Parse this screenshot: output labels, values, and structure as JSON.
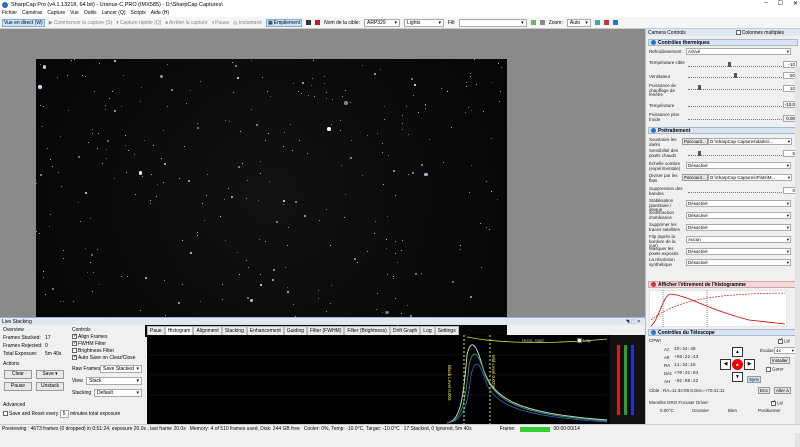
{
  "window": {
    "title": "SharpCap Pro (v4.1.13218, 64 bit) - Uranus-C PRO (IMX585) - D:\\SharpCap Captures\\"
  },
  "menu": [
    "Fichier",
    "Caméras",
    "Capture",
    "Vue",
    "Outils",
    "Lancer (Q)",
    "Scripts",
    "Aide (H)"
  ],
  "toolbar": {
    "live_view": "Vue en direct (W)",
    "start_capture": "Commencer la capture (S)",
    "quick_capture": "Capture rapide (Q)",
    "stop_capture": "Arrêter la capture",
    "pause": "Pause",
    "snapshot": "Instantané",
    "stacking": "Empilement",
    "target_label": "Nom de la cible:",
    "target_value": "ARP329",
    "frame_type": "Lights",
    "filter_label": "Filt",
    "zoom_label": "Zoom:",
    "zoom_value": "Auto"
  },
  "live_stacking": {
    "title": "Live Stacking",
    "overview_label": "Overview",
    "frames_stacked_label": "Frames Stacked:",
    "frames_stacked": "17",
    "frames_rejected_label": "Frames Rejected:",
    "frames_rejected": "0",
    "total_exposure_label": "Total Exposure:",
    "total_exposure": "5m 40s",
    "actions_label": "Actions",
    "clear": "Clear",
    "save": "Save",
    "pause": "Pause",
    "unstack": "Unstack",
    "advanced_label": "Advanced",
    "save_reset_label": "Save and Reset every",
    "save_reset_value": "5",
    "save_reset_suffix": "minutes total exposure",
    "controls_label": "Controls",
    "align_frames": "Align Frames",
    "fwhm_filter": "FWHM Filter",
    "brightness_filter": "Brightness Filter",
    "auto_save": "Auto Save on Clear/Close",
    "raw_frames_label": "Raw Frames",
    "raw_frames_value": "Save Stacked",
    "view_label": "View",
    "view_value": "Stack",
    "stacking_label": "Stacking",
    "stacking_value": "Default"
  },
  "tabs": [
    "Paue",
    "Histogram",
    "Alignment",
    "Stacking",
    "Enhancement",
    "Guiding",
    "Filter (FWHM)",
    "Filter (Brightness)",
    "Drift Graph",
    "Log",
    "Settings"
  ],
  "histogram": {
    "hist_apply": "Histo. Appl.",
    "log": "Log",
    "marker1": "Black Level 0.003",
    "marker2": "Mid Level 0.02%"
  },
  "right_panel": {
    "title": "Camera Controls",
    "multi": "Colonnes multiples",
    "thermal": {
      "title": "Contrôles thermiques",
      "cooling_label": "Refroidissement",
      "cooling_value": "Activé",
      "target_temp_label": "Température cible",
      "target_temp": "-10",
      "fan_label": "Ventilateur",
      "fan": "50",
      "heater_label": "Puissance de chauffage de fenêtre",
      "heater": "10",
      "temp_label": "Température",
      "temp": "-10.0",
      "power_label": "Puissance plus froide",
      "power": "0.00"
    },
    "preprocess": {
      "title": "Prétraitement",
      "dark_label": "Soustraire les darks",
      "browse": "Parcourir...",
      "dark_path": "D:\\SharpCap Captures\\darks\\...",
      "sens_label": "Sensibilité des pixels chauds",
      "sens": "5",
      "scale_label": "Échelle sombre (expérimentale)",
      "scale": "Désactivé",
      "flat_label": "Diviser par les flats",
      "flat_path": "D:\\SharpCap Captures\\Flats\\M...",
      "band_label": "Suppression des bandes",
      "band": "0",
      "stab_label": "Stabilisation planétaire / disque",
      "stab": "Désactivé",
      "amp_label": "Soustraction d'ambiance",
      "amp": "Désactivé",
      "sat_label": "Supprimer les traces satellites",
      "sat": "Désactivé",
      "flip_label": "Flip (après la bordure de la vue)",
      "flip": "Aucun",
      "mask_label": "Masquer les pixels exposés",
      "mask": "Désactivé",
      "res_label": "La résolution synthétique",
      "res": "Désactivé"
    },
    "histogram_section": {
      "title": "Afficher l'étirement de l'histogramme"
    },
    "telescope": {
      "title": "Contrôles du Télescope",
      "conn": "CPWI",
      "lock": "Lié",
      "alt_label": "Az",
      "alt": "19:44:40",
      "az_label": "Alt",
      "az": "+56:22:43",
      "ra_label": "RA",
      "ra": "11:34:15",
      "dec_label": "Déc",
      "dec": "+70:41:04",
      "az2_label": "AH",
      "az2": "-02:09:32",
      "rate_label": "Évaluer",
      "rate": "4x",
      "install": "Installer",
      "park": "Garer",
      "sync": "Sync",
      "target_label": "Cible : RA=11:34:08.6,Dec=+70:41:11",
      "goto": "Ens",
      "goto2": "Aller à"
    },
    "focuser": {
      "title": "Moonlite DRO Focuser Driver",
      "lock": "Lié",
      "temp": "0.00°C",
      "coarse": "Grossier",
      "fine": "Bien",
      "pos_label": "Positionner"
    }
  },
  "status": {
    "preview": "Previewing : 4673 frames (0 dropped) in 0:51:24, exposure 20.0s , last frame 20.0s",
    "memory": "Memory: 4 of 510 frames used, Disk: 244 GB free",
    "cooler": "Cooler: 0%, Temp: -10.0°C, Target: -10.0°C",
    "stack": "17 Stacked, 0 Ignored, 5m 40s",
    "frame_label": "Frame:",
    "time": "00:00:00/14"
  },
  "colors": {
    "accent": "#1e78d4",
    "header": "#d9e4f2"
  }
}
